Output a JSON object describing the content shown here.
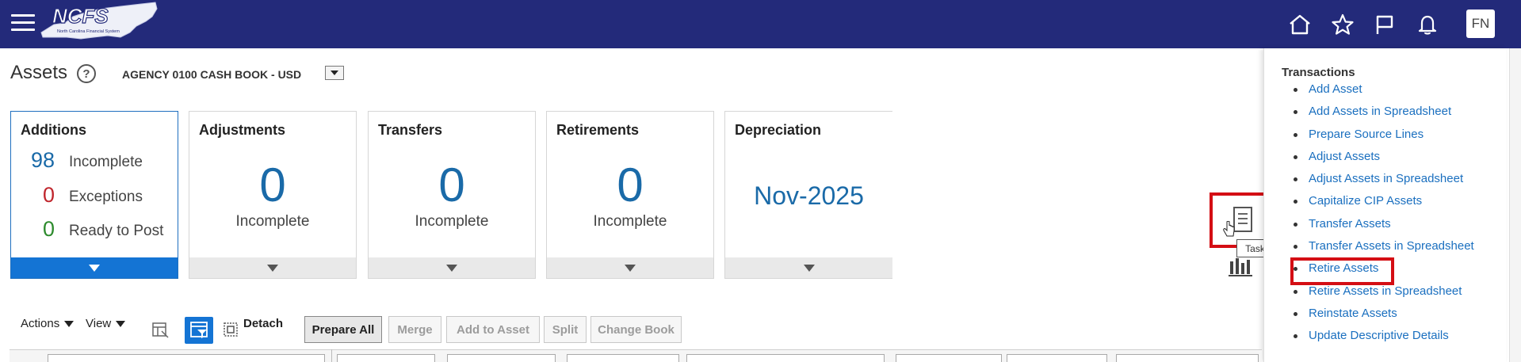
{
  "header": {
    "logo_text": "NCFS",
    "logo_tagline": "North Carolina Financial System",
    "icons": [
      "home-icon",
      "favorites-icon",
      "flag-icon",
      "notifications-icon"
    ],
    "avatar_initials": "FN"
  },
  "page": {
    "title": "Assets",
    "book": "AGENCY 0100 CASH BOOK - USD"
  },
  "cards": {
    "additions": {
      "title": "Additions",
      "incomplete_count": "98",
      "incomplete_label": "Incomplete",
      "exceptions_count": "0",
      "exceptions_label": "Exceptions",
      "ready_count": "0",
      "ready_label": "Ready to Post"
    },
    "adjustments": {
      "title": "Adjustments",
      "value": "0",
      "label": "Incomplete"
    },
    "transfers": {
      "title": "Transfers",
      "value": "0",
      "label": "Incomplete"
    },
    "retirements": {
      "title": "Retirements",
      "value": "0",
      "label": "Incomplete"
    },
    "depreciation": {
      "title": "Depreciation",
      "period": "Nov-2025"
    }
  },
  "tasks_tooltip": "Tasks",
  "panel": {
    "title": "Transactions",
    "items": [
      "Add Asset",
      "Add Assets in Spreadsheet",
      "Prepare Source Lines",
      "Adjust Assets",
      "Adjust Assets in Spreadsheet",
      "Capitalize CIP Assets",
      "Transfer Assets",
      "Transfer Assets in Spreadsheet",
      "Retire Assets",
      "Retire Assets in Spreadsheet",
      "Reinstate Assets",
      "Update Descriptive Details"
    ]
  },
  "toolbar": {
    "actions": "Actions",
    "view": "View",
    "detach": "Detach",
    "prepare_all": "Prepare All",
    "merge": "Merge",
    "add_to_asset": "Add to Asset",
    "split": "Split",
    "change_book": "Change Book"
  },
  "colors": {
    "header_bg": "#232a7a",
    "link": "#1a6fbf",
    "big_number": "#1a6aa8",
    "exceptions_red": "#c0262d",
    "ready_green": "#2e8b2e",
    "highlight_red": "#d40e14",
    "active_blue": "#1474d4"
  }
}
